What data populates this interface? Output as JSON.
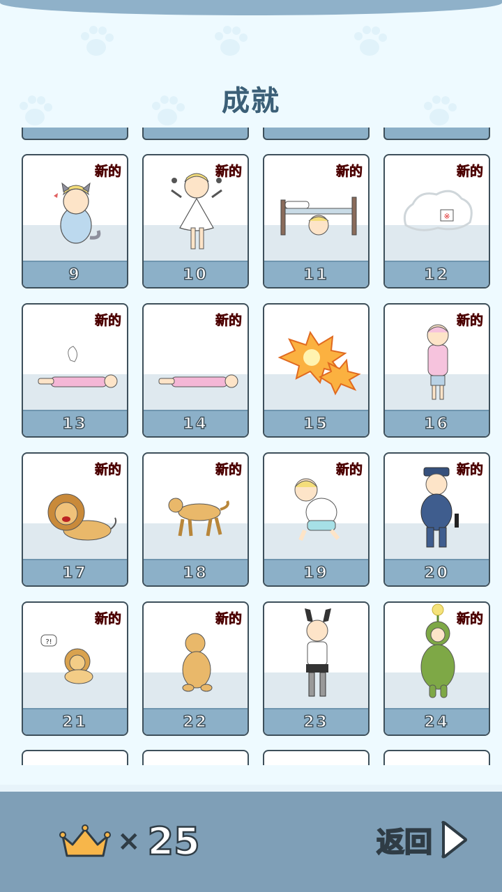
{
  "screen": {
    "title": "成就"
  },
  "new_badge_text": "新的",
  "cards": [
    {
      "number": "9",
      "is_new": true,
      "art": "cat-girl-crouching"
    },
    {
      "number": "10",
      "is_new": true,
      "art": "girl-white-dress"
    },
    {
      "number": "11",
      "is_new": true,
      "art": "under-bed"
    },
    {
      "number": "12",
      "is_new": true,
      "art": "dust-cloud"
    },
    {
      "number": "13",
      "is_new": true,
      "art": "lying-girl"
    },
    {
      "number": "14",
      "is_new": true,
      "art": "lying-girl-2"
    },
    {
      "number": "15",
      "is_new": false,
      "art": "explosion"
    },
    {
      "number": "16",
      "is_new": true,
      "art": "girl-pink-hoodie"
    },
    {
      "number": "17",
      "is_new": true,
      "art": "lion"
    },
    {
      "number": "18",
      "is_new": true,
      "art": "dog-walking"
    },
    {
      "number": "19",
      "is_new": true,
      "art": "crying-kid"
    },
    {
      "number": "20",
      "is_new": true,
      "art": "police-officer"
    },
    {
      "number": "21",
      "is_new": true,
      "art": "lion-cub"
    },
    {
      "number": "22",
      "is_new": true,
      "art": "dog-sitting"
    },
    {
      "number": "23",
      "is_new": false,
      "art": "bunny-costume"
    },
    {
      "number": "24",
      "is_new": true,
      "art": "green-costume"
    }
  ],
  "footer": {
    "crown_icon": "crown-icon",
    "multiply_sign": "×",
    "crown_count": "25",
    "back_label": "返回",
    "back_icon": "play-arrow-icon"
  },
  "colors": {
    "background": "#eefaff",
    "card_band": "#8cb0c8",
    "bar": "#7f9fb7",
    "new_badge": "#e82418",
    "title": "#3b5f77"
  }
}
